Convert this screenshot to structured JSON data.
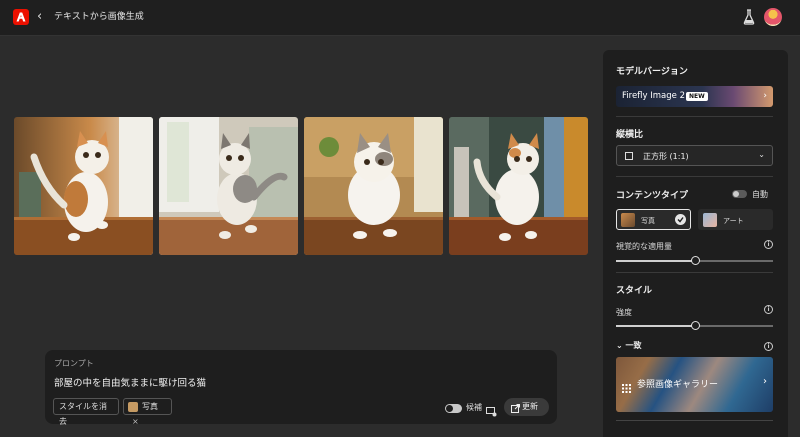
{
  "topbar": {
    "back_glyph": "‹",
    "title": "テキストから画像生成",
    "icons": [
      "adobe-logo-icon",
      "back-chevron-icon",
      "flask-icon",
      "avatar"
    ]
  },
  "images": [
    {
      "alt": "cat-running-1"
    },
    {
      "alt": "cat-running-2"
    },
    {
      "alt": "cat-running-3"
    },
    {
      "alt": "cat-running-4"
    }
  ],
  "prompt": {
    "label": "プロンプト",
    "text": "部屋の中を自由気ままに駆け回る猫",
    "clear_style": "スタイルを消去",
    "photo_chip": "写真",
    "photo_chip_remove": "×",
    "candidates_label": "候補",
    "update_button": "更新"
  },
  "panel": {
    "model_heading": "モデルバージョン",
    "model_name": "Firefly Image 2",
    "new_badge": "NEW",
    "chevron": "›",
    "aspect_heading": "縦横比",
    "aspect_value": "正方形 (1:1)",
    "content_type_heading": "コンテンツタイプ",
    "auto_label": "自動",
    "content_types": [
      "写真",
      "アート"
    ],
    "visual_intensity_label": "視覚的な適用量",
    "visual_intensity_level": 0.5,
    "style_heading": "スタイル",
    "strength_label": "強度",
    "strength_level": 0.5,
    "match_label": "一致",
    "gallery_label": "参照画像ギャラリー",
    "info_glyph": "i"
  },
  "colors": {
    "background": "#2c2c2c",
    "topbar": "#1f1f1f",
    "panel": "#1e1e1e",
    "accent_red": "#eb1000"
  }
}
